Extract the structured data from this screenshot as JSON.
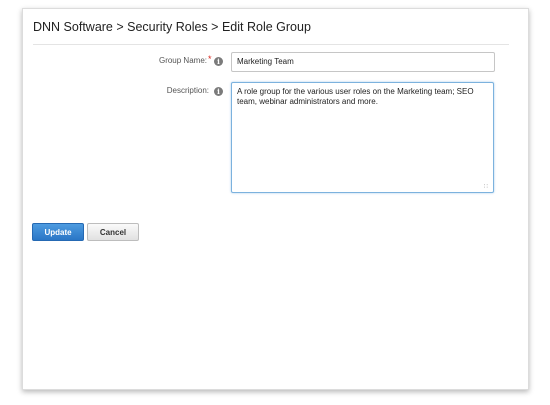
{
  "header": {
    "breadcrumb_title": "DNN Software > Security Roles > Edit Role Group"
  },
  "form": {
    "group_name": {
      "label": "Group Name:",
      "required_marker": "*",
      "value": "Marketing Team"
    },
    "description": {
      "label": "Description:",
      "value": "A role group for the various user roles on the Marketing team; SEO team, webinar administrators and more."
    },
    "help_icon": "i"
  },
  "actions": {
    "update_label": "Update",
    "cancel_label": "Cancel"
  },
  "colors": {
    "primary_button": "#2f7fd0",
    "required": "#d9241b",
    "focus_border": "#7cb2de"
  }
}
